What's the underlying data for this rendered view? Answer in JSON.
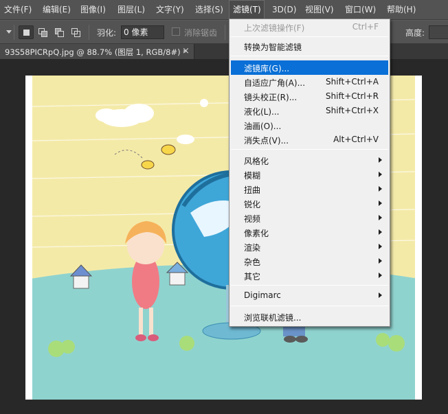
{
  "menubar": {
    "items": [
      "文件(F)",
      "编辑(E)",
      "图像(I)",
      "图层(L)",
      "文字(Y)",
      "选择(S)",
      "滤镜(T)",
      "3D(D)",
      "视图(V)",
      "窗口(W)",
      "帮助(H)"
    ]
  },
  "options": {
    "feather_label": "羽化:",
    "feather_value": "0 像素",
    "antialias_label": "消除锯齿",
    "height_label": "高度:"
  },
  "document": {
    "tab_title": "93S58PICRpQ.jpg @ 88.7% (图层 1, RGB/8#) *",
    "close": "×"
  },
  "filter_menu": {
    "last_filter": {
      "label": "上次滤镜操作(F)",
      "shortcut": "Ctrl+F"
    },
    "convert_smart": "转换为智能滤镜",
    "filter_gallery": "滤镜库(G)...",
    "adaptive_wide": {
      "label": "自适应广角(A)...",
      "shortcut": "Shift+Ctrl+A"
    },
    "lens_correction": {
      "label": "镜头校正(R)...",
      "shortcut": "Shift+Ctrl+R"
    },
    "liquify": {
      "label": "液化(L)...",
      "shortcut": "Shift+Ctrl+X"
    },
    "oil_paint": "油画(O)...",
    "vanishing_point": {
      "label": "消失点(V)...",
      "shortcut": "Alt+Ctrl+V"
    },
    "submenus": [
      "风格化",
      "模糊",
      "扭曲",
      "锐化",
      "视频",
      "像素化",
      "渲染",
      "杂色",
      "其它"
    ],
    "digimarc": "Digimarc",
    "browse_online": "浏览联机滤镜..."
  },
  "colors": {
    "highlight": "#0a6fd6",
    "menubar_bg": "#535353",
    "sky": "#f4eaa8",
    "ground": "#8fd3cf"
  }
}
